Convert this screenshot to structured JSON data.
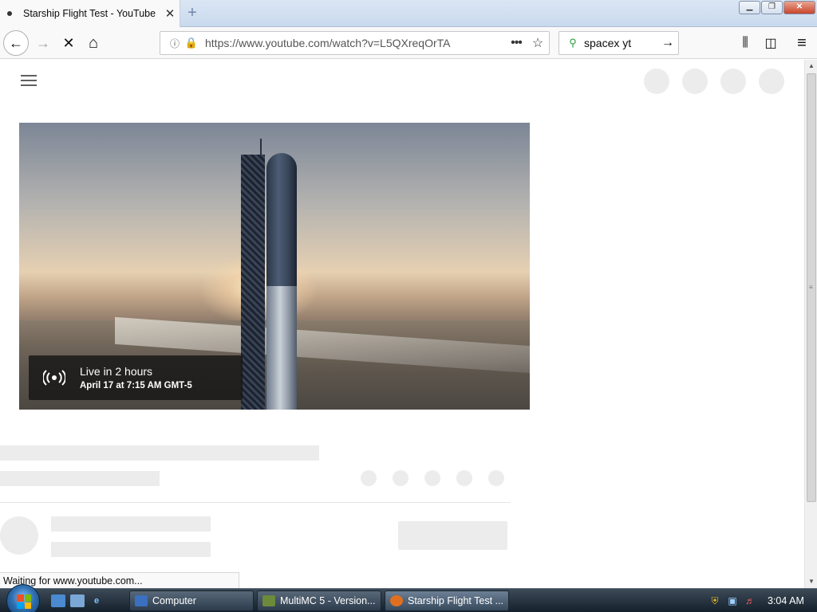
{
  "browser": {
    "tab_title": "Starship Flight Test - YouTube",
    "tab_close": "✕",
    "new_tab": "+",
    "url": "https://www.youtube.com/watch?v=L5QXreqOrTA",
    "search_value": "spacex yt",
    "window_buttons": {
      "minimize": "▁",
      "maximize": "❐",
      "close": "✕"
    },
    "nav": {
      "back": "←",
      "forward": "→",
      "stop": "✕",
      "home": "⌂",
      "page_actions": "•••",
      "bookmark": "☆",
      "search_go": "→",
      "library": "⫼",
      "sidebar": "◫",
      "menu": "≡"
    },
    "status_text": "Waiting for www.youtube.com..."
  },
  "video": {
    "live_title": "Live in 2 hours",
    "live_subtitle": "April 17 at 7:15 AM GMT-5"
  },
  "taskbar": {
    "items": [
      {
        "label": "Computer",
        "icon_color": "#3b6fbf"
      },
      {
        "label": "MultiMC 5 - Version...",
        "icon_color": "#6c8a3a"
      },
      {
        "label": "Starship Flight Test ...",
        "icon_color": "#e07020"
      }
    ],
    "clock": "3:04 AM"
  },
  "colors": {
    "accent_green": "#12bc00",
    "skeleton": "#ececec"
  }
}
